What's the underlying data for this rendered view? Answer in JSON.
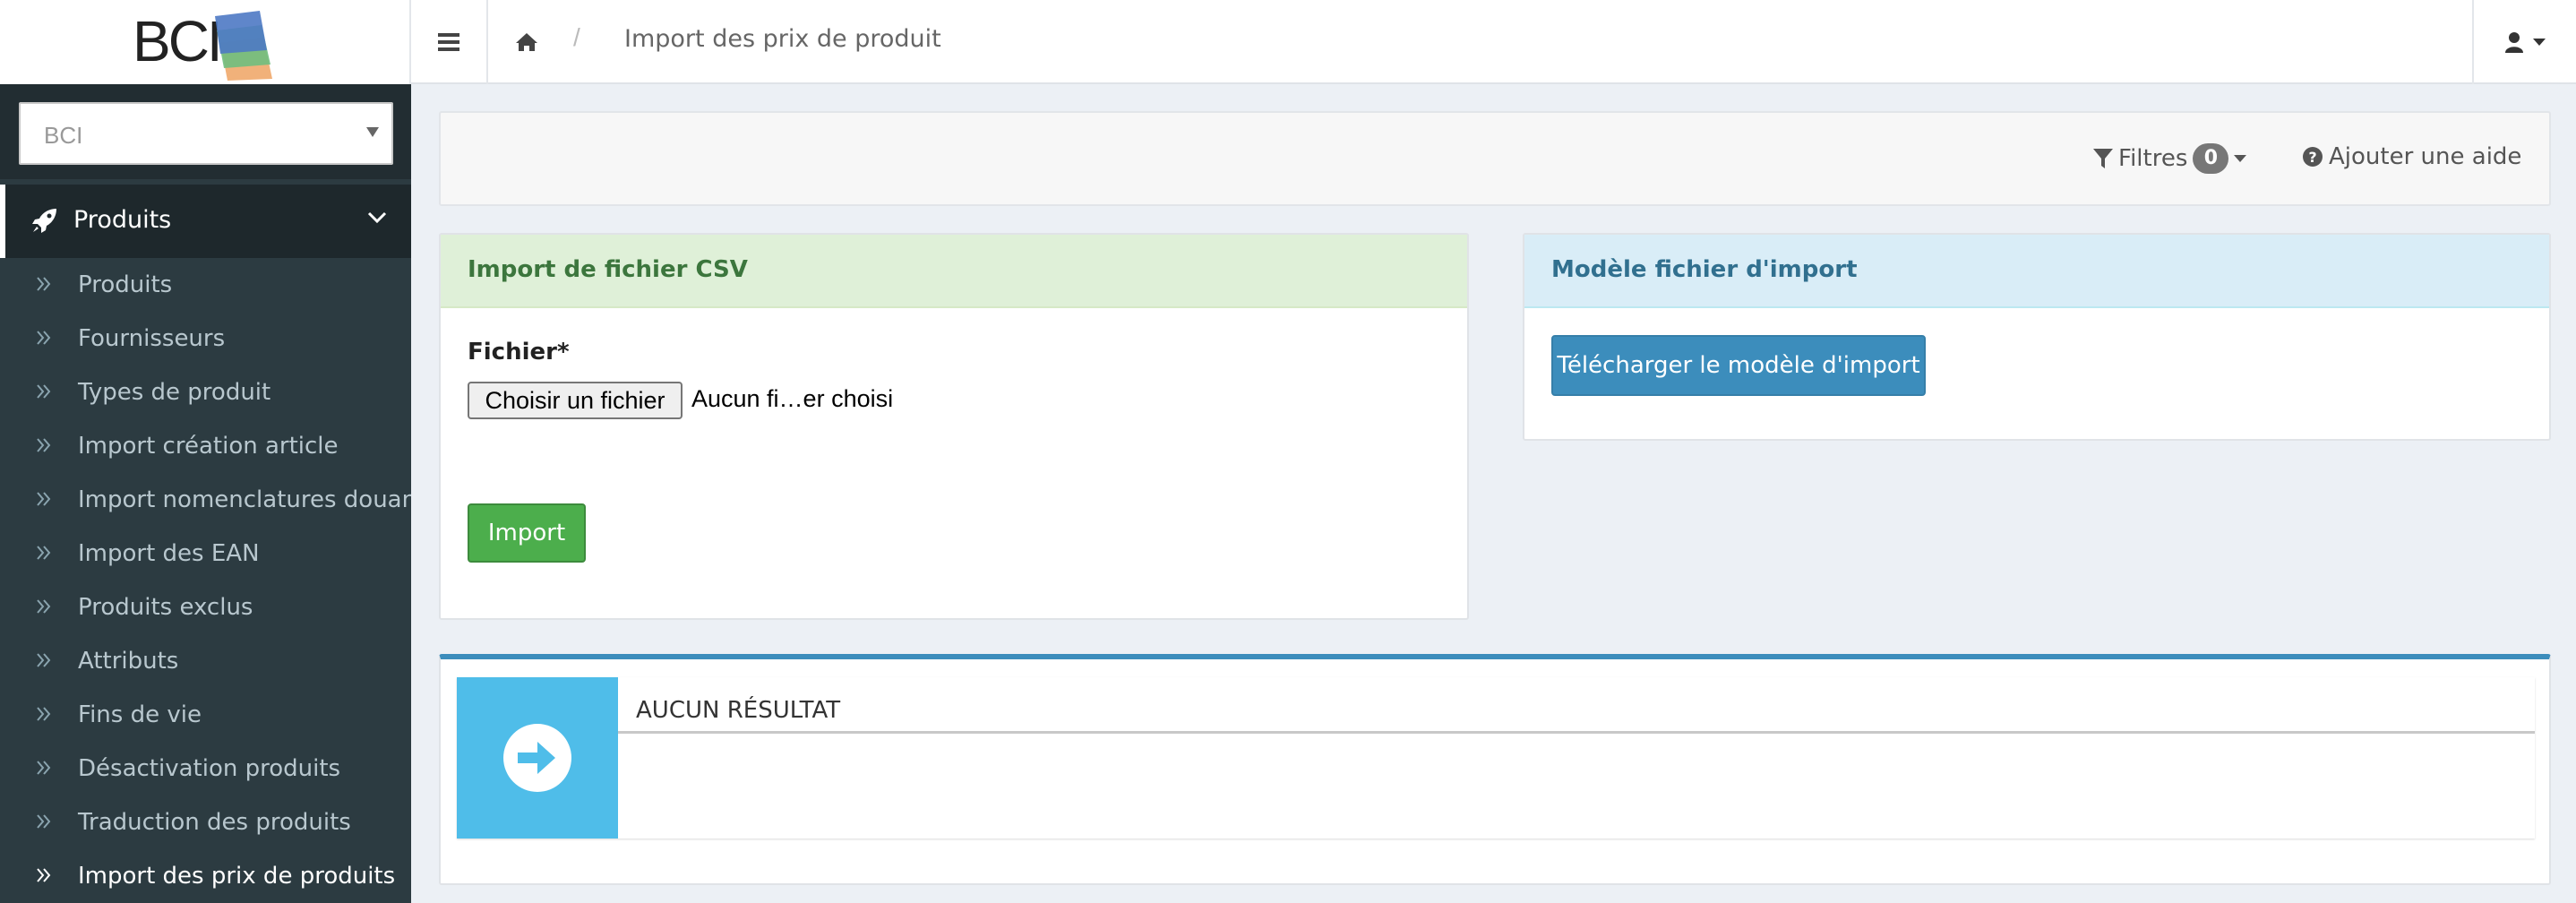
{
  "brand": {
    "logo_text": "BCI"
  },
  "breadcrumb": {
    "separator": "/",
    "current": "Import des prix de produit"
  },
  "sidebar": {
    "select_value": "BCI",
    "group_label": "Produits",
    "items": [
      {
        "label": "Produits"
      },
      {
        "label": "Fournisseurs"
      },
      {
        "label": "Types de produit"
      },
      {
        "label": "Import création article"
      },
      {
        "label": "Import nomenclatures douanières"
      },
      {
        "label": "Import des EAN"
      },
      {
        "label": "Produits exclus"
      },
      {
        "label": "Attributs"
      },
      {
        "label": "Fins de vie"
      },
      {
        "label": "Désactivation produits"
      },
      {
        "label": "Traduction des produits"
      },
      {
        "label": "Import des prix de produits"
      }
    ],
    "active_index": 11
  },
  "toolbar": {
    "filters_label": "Filtres",
    "filters_count": "0",
    "help_label": "Ajouter une aide"
  },
  "csv_panel": {
    "title": "Import de fichier CSV",
    "field_label": "Fichier*",
    "file_button": "Choisir un fichier",
    "file_status": "Aucun fi…er choisi",
    "import_button": "Import"
  },
  "model_panel": {
    "title": "Modèle fichier d'import",
    "download_button": "Télécharger le modèle d'import"
  },
  "result": {
    "text": "AUCUN RÉSULTAT"
  },
  "colors": {
    "sidebar_bg": "#2c3b41",
    "success": "#4cae4c",
    "primary": "#3c8dbc",
    "info": "#4fbde9"
  }
}
